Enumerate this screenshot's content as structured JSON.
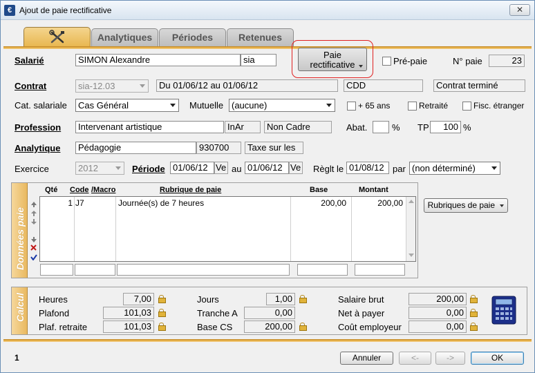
{
  "window": {
    "title": "Ajout de paie rectificative",
    "close_glyph": "✕",
    "icon_glyph": "€"
  },
  "tabs": [
    {
      "label": "",
      "icon": "tools-icon"
    },
    {
      "label": "Analytiques"
    },
    {
      "label": "Périodes"
    },
    {
      "label": "Retenues"
    }
  ],
  "salarie": {
    "label": "Salarié",
    "name": "SIMON Alexandre",
    "code": "sia"
  },
  "paie_button": {
    "label_line1": "Paie",
    "label_line2": "rectificative"
  },
  "prepaie": {
    "label": "Pré-paie"
  },
  "npaie": {
    "label": "N° paie",
    "value": "23"
  },
  "contrat": {
    "label": "Contrat",
    "value": "sia-12.03",
    "period": "Du 01/06/12 au 01/06/12",
    "type": "CDD",
    "status": "Contrat terminé"
  },
  "cat": {
    "label": "Cat. salariale",
    "value": "Cas Général"
  },
  "mutuelle": {
    "label": "Mutuelle",
    "value": "(aucune)"
  },
  "checks": {
    "plus65": "+ 65 ans",
    "retraite": "Retraité",
    "fisc": "Fisc. étranger"
  },
  "profession": {
    "label": "Profession",
    "value": "Intervenant artistique",
    "code": "InAr",
    "category": "Non Cadre"
  },
  "abat": {
    "label": "Abat.",
    "value": "",
    "unit": "%"
  },
  "tp": {
    "label": "TP",
    "value": "100",
    "unit": "%"
  },
  "analytique": {
    "label": "Analytique",
    "value": "Pédagogie",
    "code": "930700",
    "tax": "Taxe sur les"
  },
  "exercice": {
    "label": "Exercice",
    "value": "2012"
  },
  "periode": {
    "label": "Période",
    "from": "01/06/12",
    "from_day": "Ve",
    "au": "au",
    "to": "01/06/12",
    "to_day": "Ve"
  },
  "reglt": {
    "label": "Règlt le",
    "date": "01/08/12",
    "par": "par",
    "mode": "(non déterminé)"
  },
  "donnees": {
    "side_label": "Données paie",
    "headers": {
      "qte": "Qté",
      "code": "Code",
      "macro": "/Macro",
      "rubrique": "Rubrique de paie",
      "base": "Base",
      "montant": "Montant"
    },
    "rows": [
      {
        "qte": "1",
        "code": "J7",
        "rubrique": "Journée(s) de 7 heures",
        "base": "200,00",
        "montant": "200,00"
      }
    ],
    "rubriques_button": "Rubriques de paie"
  },
  "calcul": {
    "side_label": "Calcul",
    "heures": {
      "label": "Heures",
      "value": "7,00"
    },
    "plafond": {
      "label": "Plafond",
      "value": "101,03"
    },
    "plaf_retraite": {
      "label": "Plaf. retraite",
      "value": "101,03"
    },
    "jours": {
      "label": "Jours",
      "value": "1,00"
    },
    "tranche_a": {
      "label": "Tranche A",
      "value": "0,00"
    },
    "base_cs": {
      "label": "Base CS",
      "value": "200,00"
    },
    "salaire_brut": {
      "label": "Salaire brut",
      "value": "200,00"
    },
    "net_payer": {
      "label": "Net à payer",
      "value": "0,00"
    },
    "cout_employeur": {
      "label": "Coût employeur",
      "value": "0,00"
    }
  },
  "footer": {
    "page": "1",
    "annuler": "Annuler",
    "prev": "<-",
    "next": "->",
    "ok": "OK"
  },
  "colors": {
    "accent": "#e3ad47",
    "highlight": "#e02020"
  }
}
